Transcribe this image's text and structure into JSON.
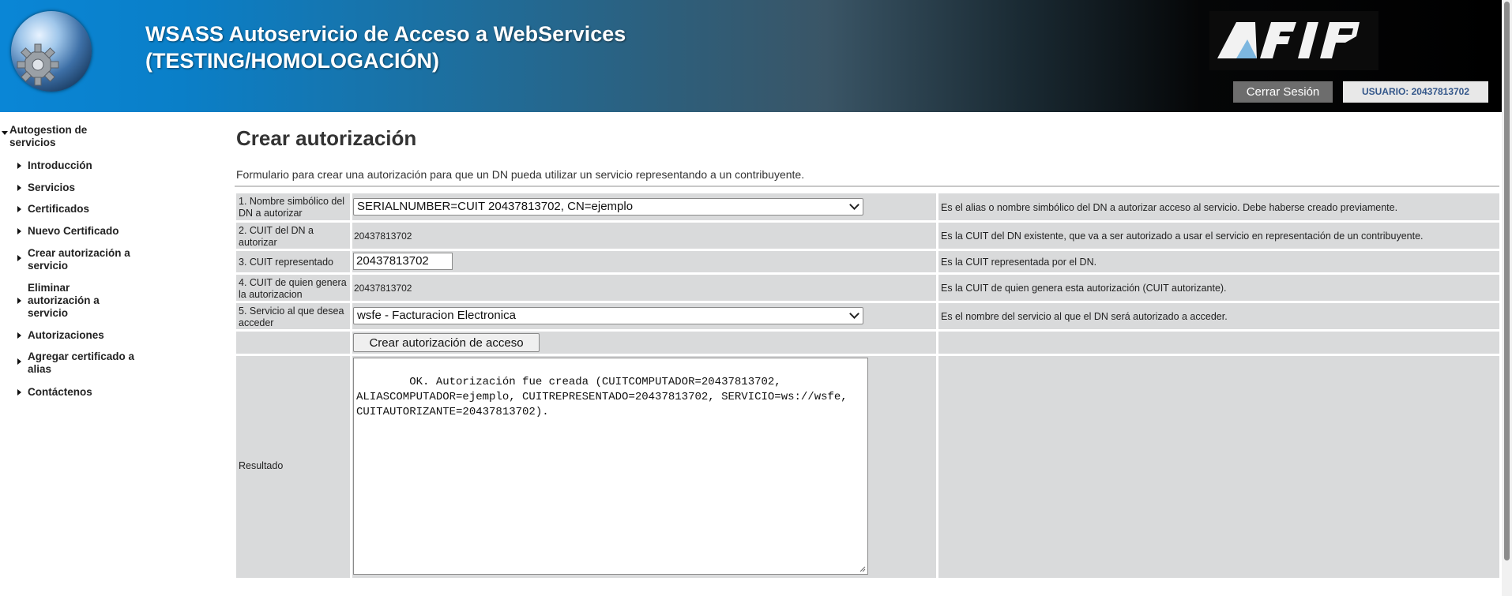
{
  "header": {
    "title_line1": "WSASS Autoservicio de Acceso a WebServices",
    "title_line2": "(TESTING/HOMOLOGACIÓN)",
    "logo_text": "AFIP",
    "logout_label": "Cerrar Sesión",
    "user_label": "USUARIO: 20437813702"
  },
  "sidebar": {
    "root": "Autogestion de servicios",
    "items": [
      {
        "label": "Introducción"
      },
      {
        "label": "Servicios"
      },
      {
        "label": "Certificados"
      },
      {
        "label": "Nuevo Certificado"
      },
      {
        "label": "Crear autorización a servicio"
      },
      {
        "label": "Eliminar autorización a servicio"
      },
      {
        "label": "Autorizaciones"
      },
      {
        "label": "Agregar certificado a alias"
      },
      {
        "label": "Contáctenos"
      }
    ]
  },
  "main": {
    "title": "Crear autorización",
    "description": "Formulario para crear una autorización para que un DN pueda utilizar un servicio representando a un contribuyente."
  },
  "form": {
    "rows": [
      {
        "label": "1. Nombre simbólico del DN a autorizar",
        "value": "SERIALNUMBER=CUIT 20437813702, CN=ejemplo",
        "help": "Es el alias o nombre simbólico del DN a autorizar acceso al servicio. Debe haberse creado previamente."
      },
      {
        "label": "2. CUIT del DN a autorizar",
        "value": "20437813702",
        "help": "Es la CUIT del DN existente, que va a ser autorizado a usar el servicio en representación de un contribuyente."
      },
      {
        "label": "3. CUIT representado",
        "value": "20437813702",
        "help": "Es la CUIT representada por el DN."
      },
      {
        "label": "4. CUIT de quien genera la autorizacion",
        "value": "20437813702",
        "help": "Es la CUIT de quien genera esta autorización (CUIT autorizante)."
      },
      {
        "label": "5. Servicio al que desea acceder",
        "value": "wsfe - Facturacion Electronica",
        "help": "Es el nombre del servicio al que el DN será autorizado a acceder."
      }
    ],
    "submit_label": "Crear autorización de acceso",
    "result_label": "Resultado",
    "result_text": "OK. Autorización fue creada (CUITCOMPUTADOR=20437813702,\nALIASCOMPUTADOR=ejemplo, CUITREPRESENTADO=20437813702, SERVICIO=ws://wsfe,\nCUITAUTORIZANTE=20437813702)."
  },
  "colors": {
    "header_blue": "#0a86d6",
    "header_black": "#000000",
    "form_cell_bg": "#d9dadb",
    "user_text": "#34578a"
  }
}
